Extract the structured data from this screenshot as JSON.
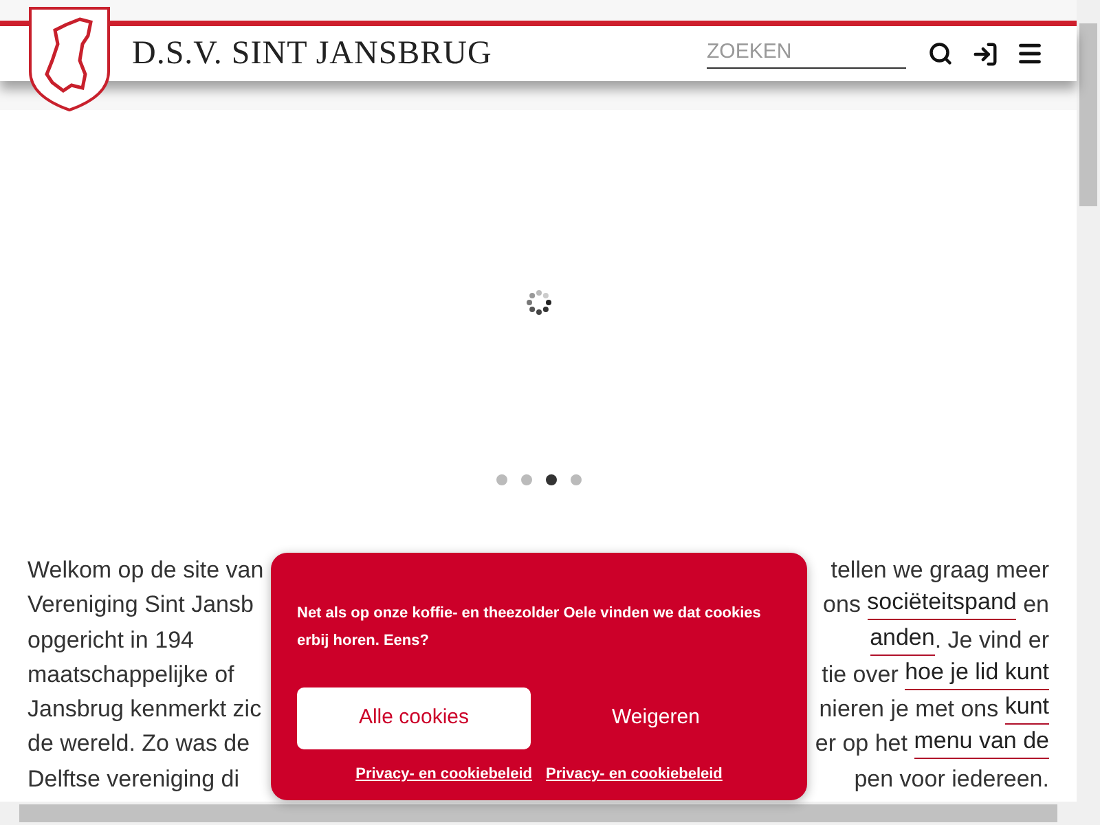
{
  "header": {
    "title": "D.S.V. SINT JANSBRUG",
    "search": {
      "placeholder": "ZOEKEN"
    }
  },
  "slider": {
    "dots": [
      {
        "selected": false
      },
      {
        "selected": false
      },
      {
        "selected": true
      },
      {
        "selected": false
      }
    ]
  },
  "intro": {
    "lines": [
      {
        "left": "Welkom op de site van",
        "right": [
          {
            "text": "tellen we graag meer",
            "kind": "text"
          }
        ]
      },
      {
        "left": "Vereniging Sint Jansb",
        "right": [
          {
            "text": "ons ",
            "kind": "text"
          },
          {
            "text": "sociëteitspand",
            "kind": "link"
          },
          {
            "text": " en",
            "kind": "text"
          }
        ]
      },
      {
        "left": "opgericht in 194",
        "right": [
          {
            "text": "anden",
            "kind": "link"
          },
          {
            "text": ". Je vind er",
            "kind": "text"
          }
        ]
      },
      {
        "left": "maatschappelijke of",
        "right": [
          {
            "text": "tie over ",
            "kind": "text"
          },
          {
            "text": "hoe je lid kunt",
            "kind": "link"
          }
        ]
      },
      {
        "left": "Jansbrug kenmerkt zic",
        "right": [
          {
            "text": "nieren je met ons ",
            "kind": "text"
          },
          {
            "text": "kunt",
            "kind": "link"
          }
        ]
      },
      {
        "left": "de wereld. Zo was de",
        "right": [
          {
            "text": "er op het ",
            "kind": "text"
          },
          {
            "text": "menu van de",
            "kind": "link"
          }
        ]
      },
      {
        "left": "Delftse vereniging di",
        "right": [
          {
            "text": "pen voor iedereen.",
            "kind": "text"
          }
        ]
      }
    ]
  },
  "cookie_banner": {
    "message": "Net als op onze koffie- en theezolder Oele vinden we dat cookies erbij horen. Eens?",
    "buttons": [
      {
        "label": "Alle cookies",
        "kind": "primary"
      },
      {
        "label": "Weigeren",
        "kind": "plain"
      }
    ],
    "links": [
      "Privacy- en cookiebeleid",
      "Privacy- en cookiebeleid"
    ]
  }
}
